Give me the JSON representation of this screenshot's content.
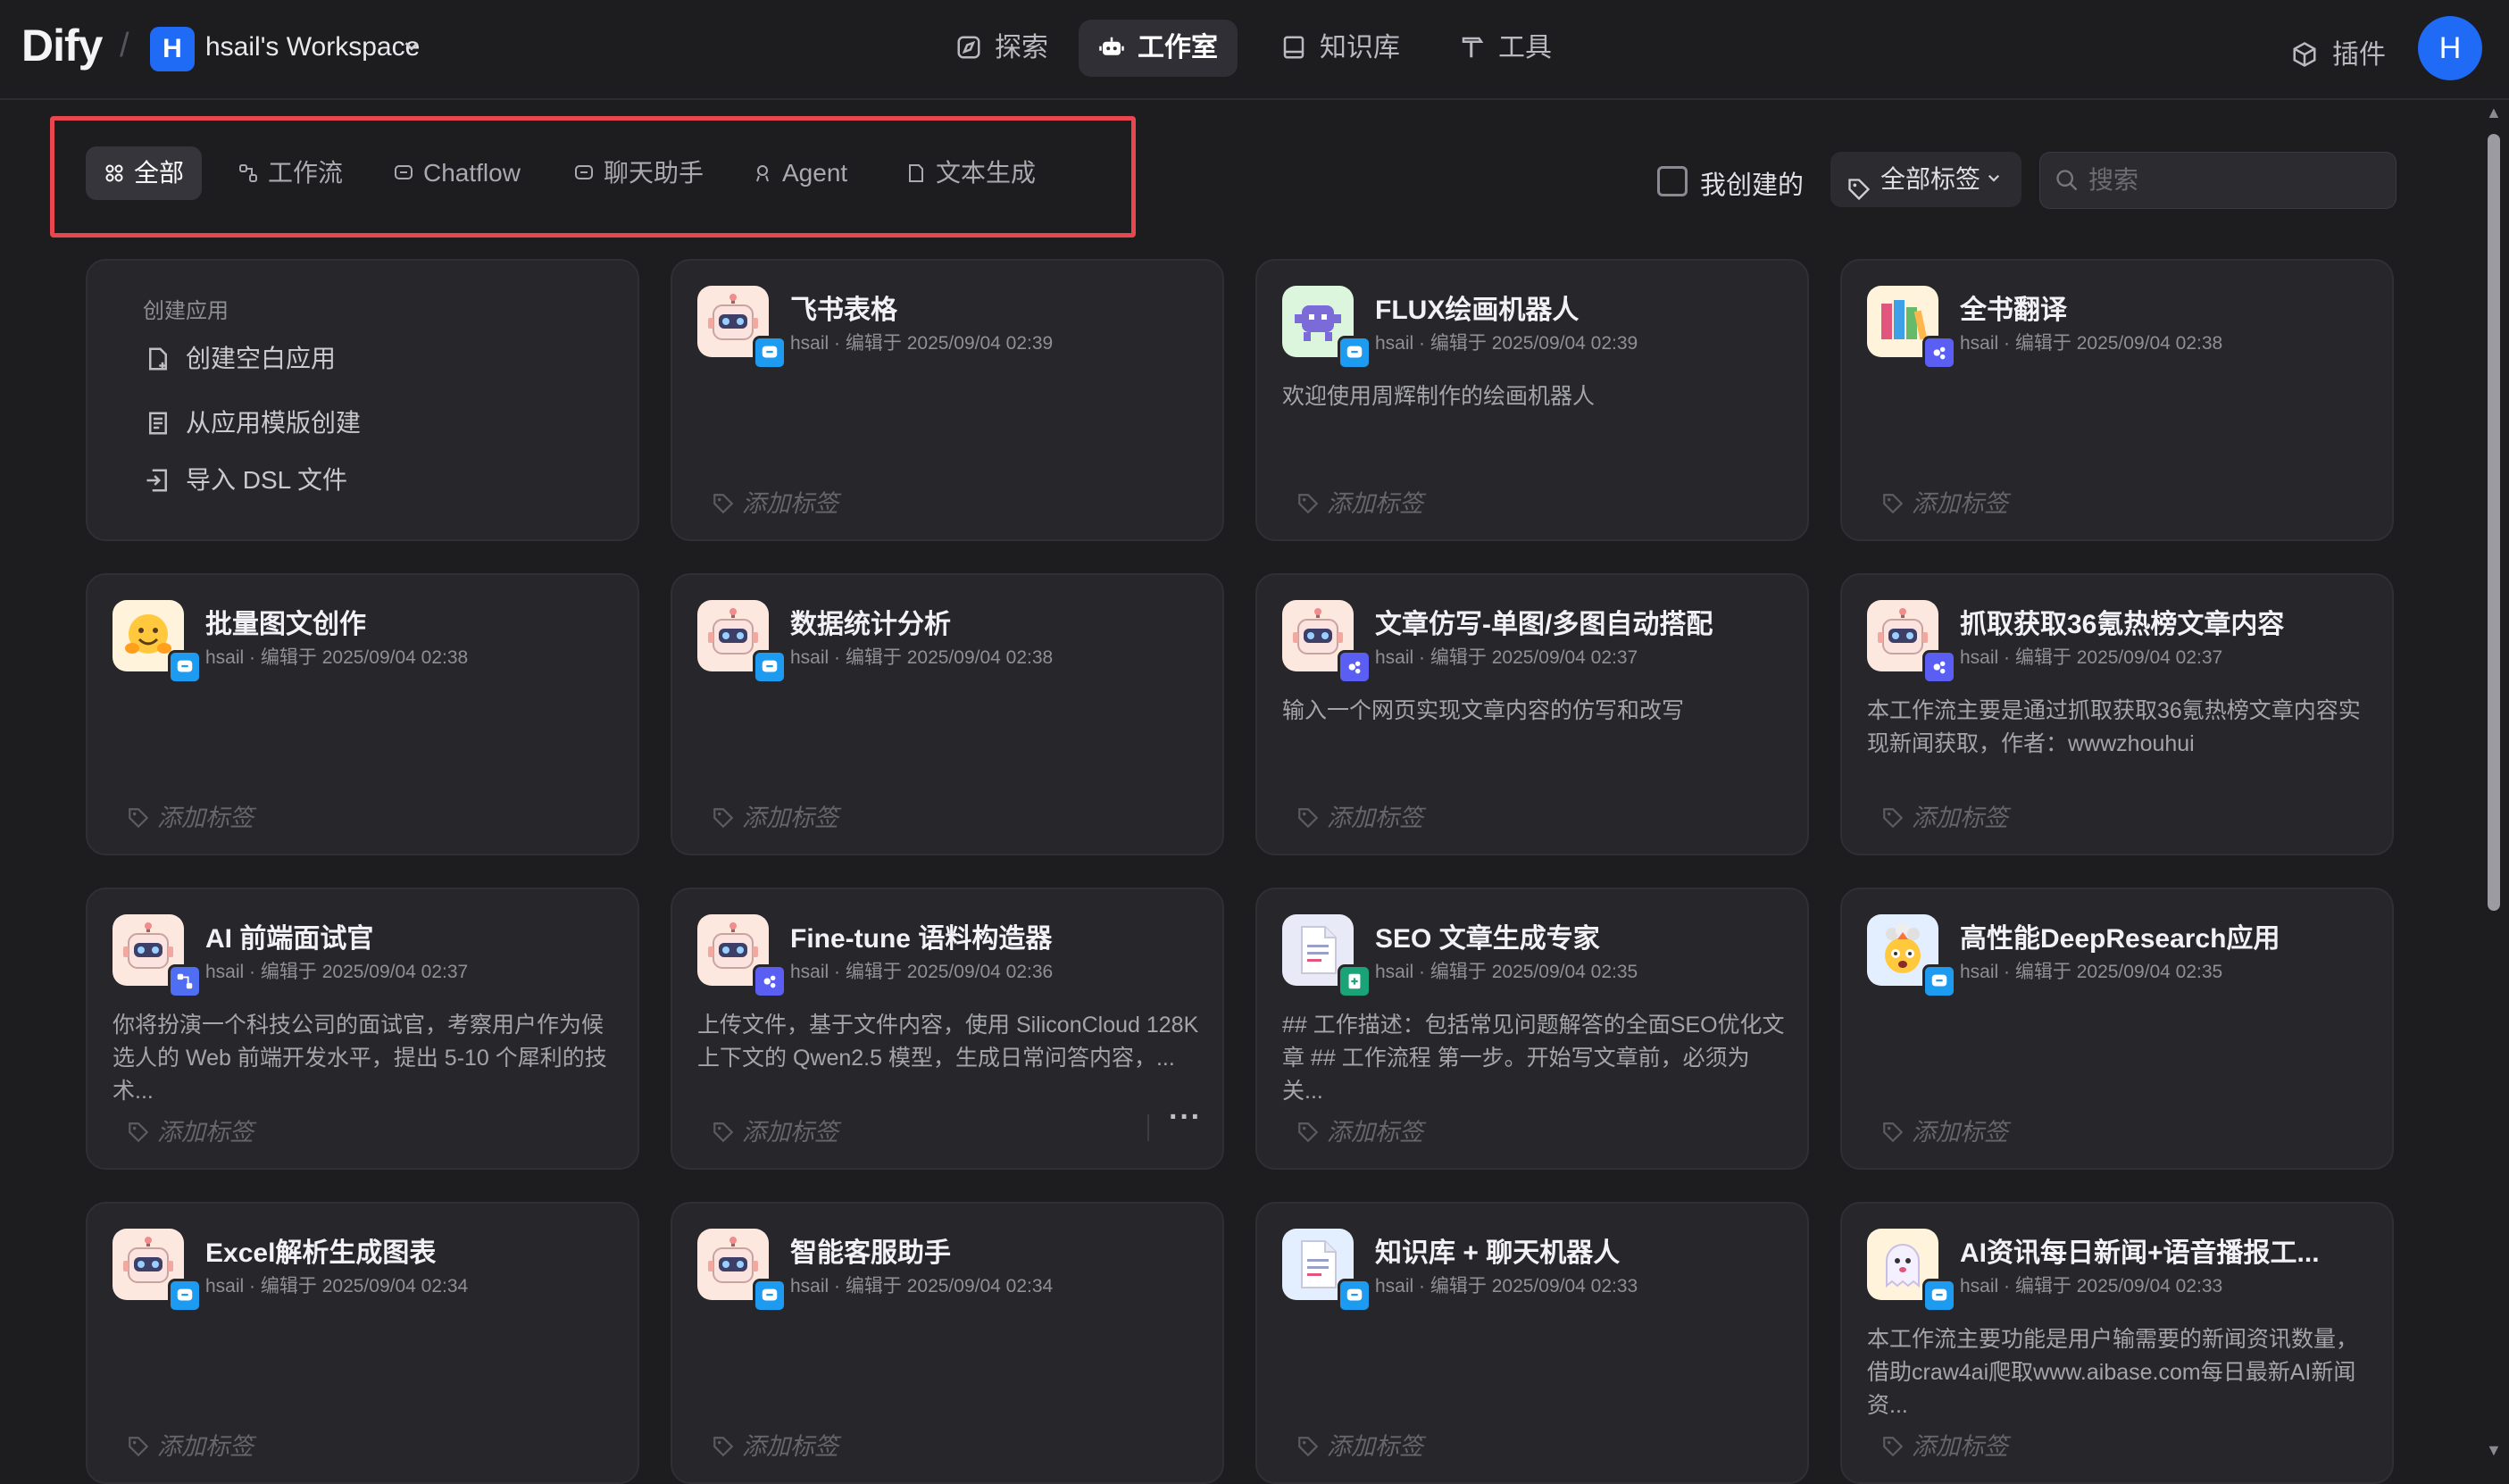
{
  "header": {
    "logo": "Dify",
    "separator": "/",
    "workspace_initial": "H",
    "workspace_name": "hsail's Workspace",
    "nav": [
      {
        "label": "探索",
        "icon": "compass-icon"
      },
      {
        "label": "工作室",
        "icon": "robot-icon",
        "active": true
      },
      {
        "label": "知识库",
        "icon": "book-icon"
      },
      {
        "label": "工具",
        "icon": "hammer-icon"
      }
    ],
    "plugins_label": "插件",
    "user_initial": "H"
  },
  "filters": {
    "tabs": [
      {
        "label": "全部",
        "icon": "grid-icon",
        "active": true
      },
      {
        "label": "工作流",
        "icon": "workflow-icon"
      },
      {
        "label": "Chatflow",
        "icon": "chatflow-icon"
      },
      {
        "label": "聊天助手",
        "icon": "chat-bubble-icon"
      },
      {
        "label": "Agent",
        "icon": "agent-icon"
      },
      {
        "label": "文本生成",
        "icon": "document-icon"
      }
    ],
    "mine_label": "我创建的",
    "mine_checked": false,
    "tag_filter_label": "全部标签",
    "search_placeholder": "搜索"
  },
  "create_card": {
    "title": "创建应用",
    "items": [
      "创建空白应用",
      "从应用模版创建",
      "导入 DSL 文件"
    ]
  },
  "tag_placeholder": "添加标签",
  "apps": [
    {
      "name": "飞书表格",
      "author": "hsail",
      "edited": "编辑于 2025/09/04 02:39",
      "desc": "",
      "icon": "robot-icon",
      "icon_bg": "peach",
      "badge": "chat"
    },
    {
      "name": "FLUX绘画机器人",
      "author": "hsail",
      "edited": "编辑于 2025/09/04 02:39",
      "desc": "欢迎使用周辉制作的绘画机器人",
      "icon": "alien-monster-icon",
      "icon_bg": "green",
      "badge": "chat"
    },
    {
      "name": "全书翻译",
      "author": "hsail",
      "edited": "编辑于 2025/09/04 02:38",
      "desc": "",
      "icon": "books-icon",
      "icon_bg": "cream",
      "badge": "agent"
    },
    {
      "name": "批量图文创作",
      "author": "hsail",
      "edited": "编辑于 2025/09/04 02:38",
      "desc": "",
      "icon": "hugging-face-icon",
      "icon_bg": "cream",
      "badge": "chat"
    },
    {
      "name": "数据统计分析",
      "author": "hsail",
      "edited": "编辑于 2025/09/04 02:38",
      "desc": "",
      "icon": "robot-icon",
      "icon_bg": "peach",
      "badge": "chat"
    },
    {
      "name": "文章仿写-单图/多图自动搭配",
      "author": "hsail",
      "edited": "编辑于 2025/09/04 02:37",
      "desc": "输入一个网页实现文章内容的仿写和改写",
      "icon": "robot-icon",
      "icon_bg": "peach",
      "badge": "agent"
    },
    {
      "name": "抓取获取36氪热榜文章内容",
      "author": "hsail",
      "edited": "编辑于 2025/09/04 02:37",
      "desc": "本工作流主要是通过抓取获取36氪热榜文章内容实现新闻获取，作者：wwwzhouhui",
      "icon": "robot-icon",
      "icon_bg": "peach",
      "badge": "agent"
    },
    {
      "name": "AI 前端面试官",
      "author": "hsail",
      "edited": "编辑于 2025/09/04 02:37",
      "desc": "你将扮演一个科技公司的面试官，考察用户作为候选人的 Web 前端开发水平，提出 5-10 个犀利的技术...",
      "icon": "robot-icon",
      "icon_bg": "peach",
      "badge": "wf"
    },
    {
      "name": "Fine-tune 语料构造器",
      "author": "hsail",
      "edited": "编辑于 2025/09/04 02:36",
      "desc": "上传文件，基于文件内容，使用 SiliconCloud 128K 上下文的 Qwen2.5 模型，生成日常问答内容，...",
      "icon": "robot-icon",
      "icon_bg": "peach",
      "badge": "agent",
      "more": true
    },
    {
      "name": "SEO 文章生成专家",
      "author": "hsail",
      "edited": "编辑于 2025/09/04 02:35",
      "desc": "## 工作描述：包括常见问题解答的全面SEO优化文章 ## 工作流程 第一步。开始写文章前，必须为关...",
      "icon": "document-icon",
      "icon_bg": "lavender",
      "badge": "text"
    },
    {
      "name": "高性能DeepResearch应用",
      "author": "hsail",
      "edited": "编辑于 2025/09/04 02:35",
      "desc": "",
      "icon": "exploding-head-icon",
      "icon_bg": "blue",
      "badge": "chat"
    },
    {
      "name": "Excel解析生成图表",
      "author": "hsail",
      "edited": "编辑于 2025/09/04 02:34",
      "desc": "",
      "icon": "robot-icon",
      "icon_bg": "peach",
      "badge": "chat"
    },
    {
      "name": "智能客服助手",
      "author": "hsail",
      "edited": "编辑于 2025/09/04 02:34",
      "desc": "",
      "icon": "robot-icon",
      "icon_bg": "peach",
      "badge": "chat"
    },
    {
      "name": "知识库 + 聊天机器人",
      "author": "hsail",
      "edited": "编辑于 2025/09/04 02:33",
      "desc": "",
      "icon": "document-icon",
      "icon_bg": "blue",
      "badge": "chat"
    },
    {
      "name": "AI资讯每日新闻+语音播报工...",
      "author": "hsail",
      "edited": "编辑于 2025/09/04 02:33",
      "desc": "本工作流主要功能是用户输需要的新闻资讯数量，借助craw4ai爬取www.aibase.com每日最新AI新闻资...",
      "icon": "ghost-icon",
      "icon_bg": "cream",
      "badge": "chat"
    }
  ]
}
